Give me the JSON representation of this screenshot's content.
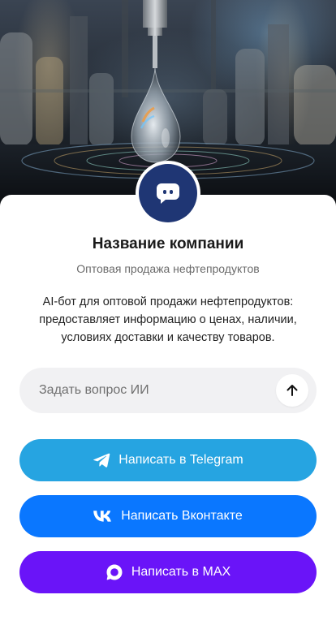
{
  "company": {
    "name": "Название компании",
    "subtitle": "Оптовая продажа нефтепродуктов",
    "description": "AI-бот для оптовой продажи нефтепродуктов: предоставляет информацию о ценах, наличии, условиях доставки и качеству товаров."
  },
  "ask": {
    "placeholder": "Задать вопрос ИИ",
    "value": ""
  },
  "buttons": {
    "telegram": "Написать в Telegram",
    "vk": "Написать Вконтакте",
    "max": "Написать в MAX"
  },
  "icons": {
    "avatar": "chat-bubble-icon",
    "send": "arrow-up-icon",
    "telegram": "telegram-icon",
    "vk": "vk-icon",
    "max": "max-icon"
  },
  "colors": {
    "avatar_bg": "#1f3674",
    "telegram": "#26a4e1",
    "vk": "#0a77ff",
    "max": "#6a14f8",
    "input_bg": "#f1f1f3"
  }
}
